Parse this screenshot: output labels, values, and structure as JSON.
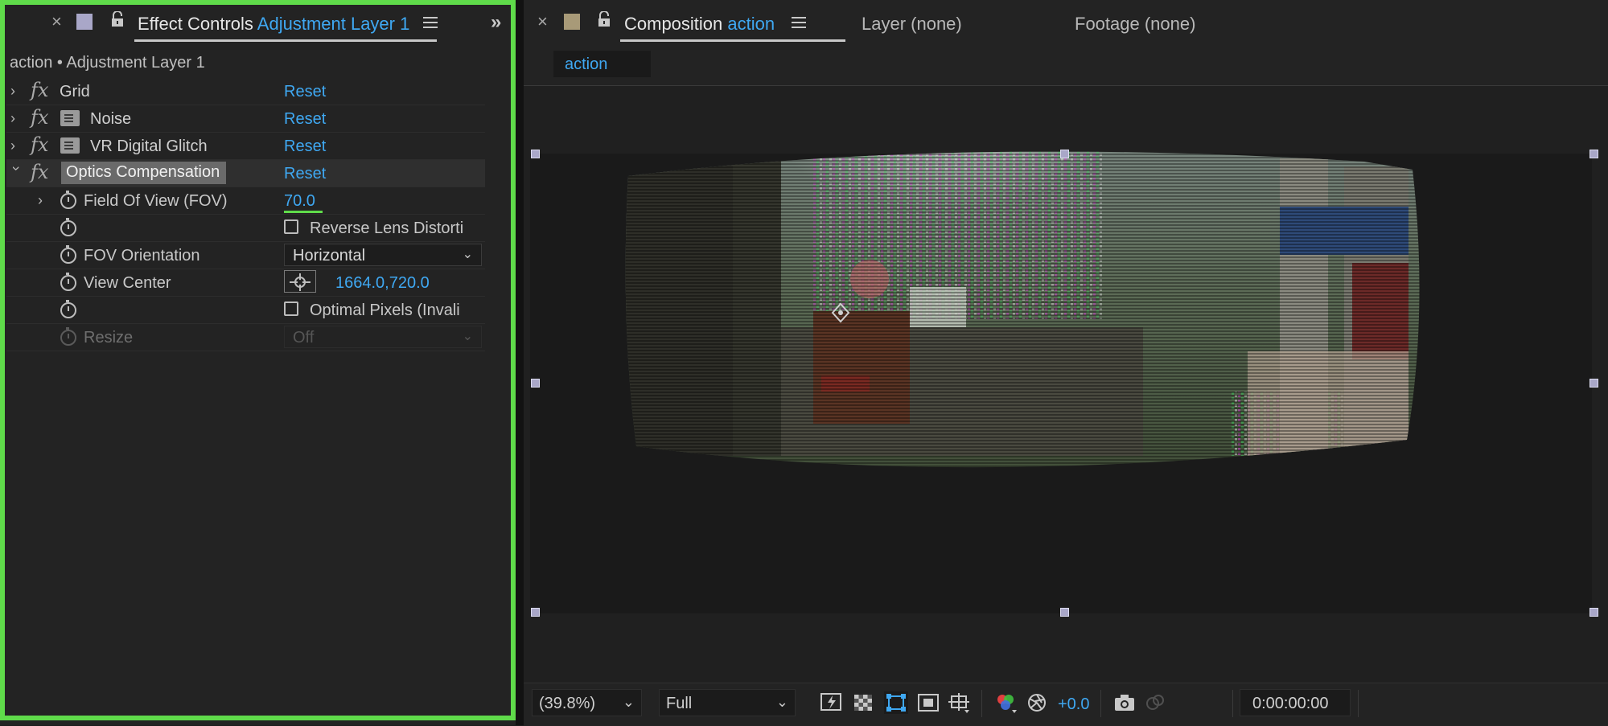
{
  "effect_controls": {
    "tab_prefix": "Effect Controls",
    "tab_layer": "Adjustment Layer 1",
    "breadcrumb": "action • Adjustment Layer 1",
    "reset_label": "Reset",
    "effects": [
      {
        "name": "Grid",
        "expanded": false,
        "has_badge": false
      },
      {
        "name": "Noise",
        "expanded": false,
        "has_badge": true
      },
      {
        "name": "VR Digital Glitch",
        "expanded": false,
        "has_badge": true
      },
      {
        "name": "Optics Compensation",
        "expanded": true,
        "has_badge": false,
        "selected": true
      }
    ],
    "params": {
      "fov_label": "Field Of View (FOV)",
      "fov_value": "70.0",
      "reverse_label": "Reverse Lens Distorti",
      "orientation_label": "FOV Orientation",
      "orientation_value": "Horizontal",
      "view_center_label": "View Center",
      "view_center_value": "1664.0,720.0",
      "optimal_label": "Optimal Pixels (Invali",
      "resize_label": "Resize",
      "resize_value": "Off"
    }
  },
  "composition": {
    "tab_prefix": "Composition",
    "tab_name": "action",
    "layer_tab": "Layer (none)",
    "footage_tab": "Footage (none)",
    "comp_tab": "action"
  },
  "viewer_toolbar": {
    "zoom": "(39.8%)",
    "resolution": "Full",
    "exposure": "+0.0",
    "timecode": "0:00:00:00"
  },
  "colors": {
    "accent": "#3fa8f2",
    "highlight": "#5fdb4a",
    "effect_label_swatch": "#a9a7c8",
    "comp_label_swatch": "#a89a78"
  }
}
